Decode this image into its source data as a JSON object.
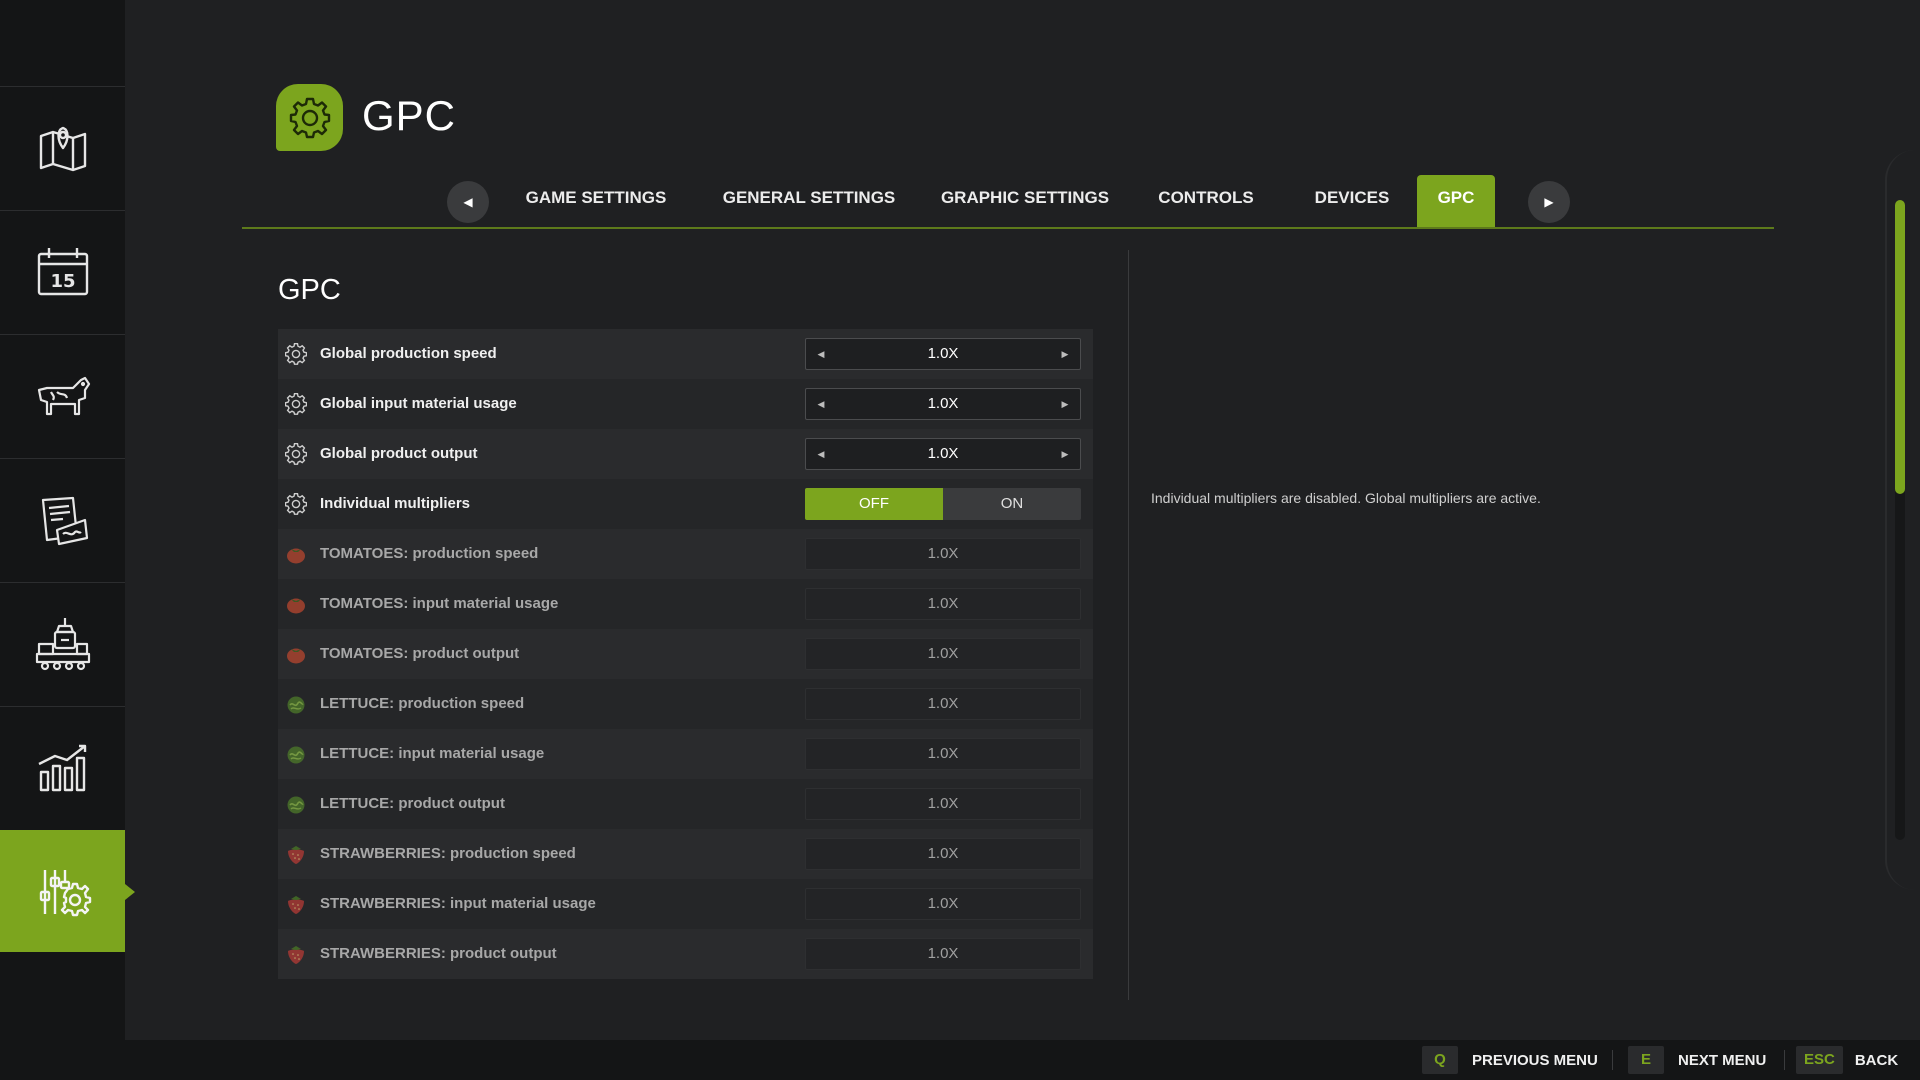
{
  "sidebar": {
    "items": [
      {
        "icon": "map-pin-icon"
      },
      {
        "icon": "calendar-icon",
        "day": "15"
      },
      {
        "icon": "cow-icon"
      },
      {
        "icon": "contracts-icon"
      },
      {
        "icon": "production-icon"
      },
      {
        "icon": "statistics-icon"
      },
      {
        "icon": "settings-sliders-icon",
        "active": true
      }
    ]
  },
  "header": {
    "title": "GPC",
    "icon": "gear-icon"
  },
  "tabs": {
    "items": [
      {
        "label": "GAME SETTINGS"
      },
      {
        "label": "GENERAL SETTINGS"
      },
      {
        "label": "GRAPHIC SETTINGS"
      },
      {
        "label": "CONTROLS"
      },
      {
        "label": "DEVICES"
      },
      {
        "label": "GPC",
        "active": true
      }
    ]
  },
  "section": {
    "title": "GPC",
    "info": "Individual multipliers are disabled. Global multipliers are active."
  },
  "settings": [
    {
      "icon": "gear-icon",
      "label": "Global production speed",
      "value": "1.0X",
      "type": "stepper"
    },
    {
      "icon": "gear-icon",
      "label": "Global input material usage",
      "value": "1.0X",
      "type": "stepper"
    },
    {
      "icon": "gear-icon",
      "label": "Global product output",
      "value": "1.0X",
      "type": "stepper"
    },
    {
      "icon": "gear-icon",
      "label": "Individual multipliers",
      "type": "toggle",
      "off_label": "OFF",
      "on_label": "ON",
      "selected": "OFF"
    },
    {
      "icon": "tomato-icon",
      "label": "TOMATOES: production speed",
      "value": "1.0X",
      "type": "disabled"
    },
    {
      "icon": "tomato-icon",
      "label": "TOMATOES: input material usage",
      "value": "1.0X",
      "type": "disabled"
    },
    {
      "icon": "tomato-icon",
      "label": "TOMATOES: product output",
      "value": "1.0X",
      "type": "disabled"
    },
    {
      "icon": "lettuce-icon",
      "label": "LETTUCE: production speed",
      "value": "1.0X",
      "type": "disabled"
    },
    {
      "icon": "lettuce-icon",
      "label": "LETTUCE: input material usage",
      "value": "1.0X",
      "type": "disabled"
    },
    {
      "icon": "lettuce-icon",
      "label": "LETTUCE: product output",
      "value": "1.0X",
      "type": "disabled"
    },
    {
      "icon": "strawberry-icon",
      "label": "STRAWBERRIES: production speed",
      "value": "1.0X",
      "type": "disabled"
    },
    {
      "icon": "strawberry-icon",
      "label": "STRAWBERRIES: input material usage",
      "value": "1.0X",
      "type": "disabled"
    },
    {
      "icon": "strawberry-icon",
      "label": "STRAWBERRIES: product output",
      "value": "1.0X",
      "type": "disabled"
    }
  ],
  "scrollbar": {
    "position": 0.0,
    "visible_fraction": 0.46
  },
  "bottom_bar": {
    "hints": [
      {
        "key": "Q",
        "label": "PREVIOUS MENU"
      },
      {
        "key": "E",
        "label": "NEXT MENU"
      },
      {
        "key": "ESC",
        "label": "BACK"
      }
    ]
  },
  "colors": {
    "accent": "#7ca51e",
    "background": "#1f2022",
    "sidebar": "#141516"
  }
}
